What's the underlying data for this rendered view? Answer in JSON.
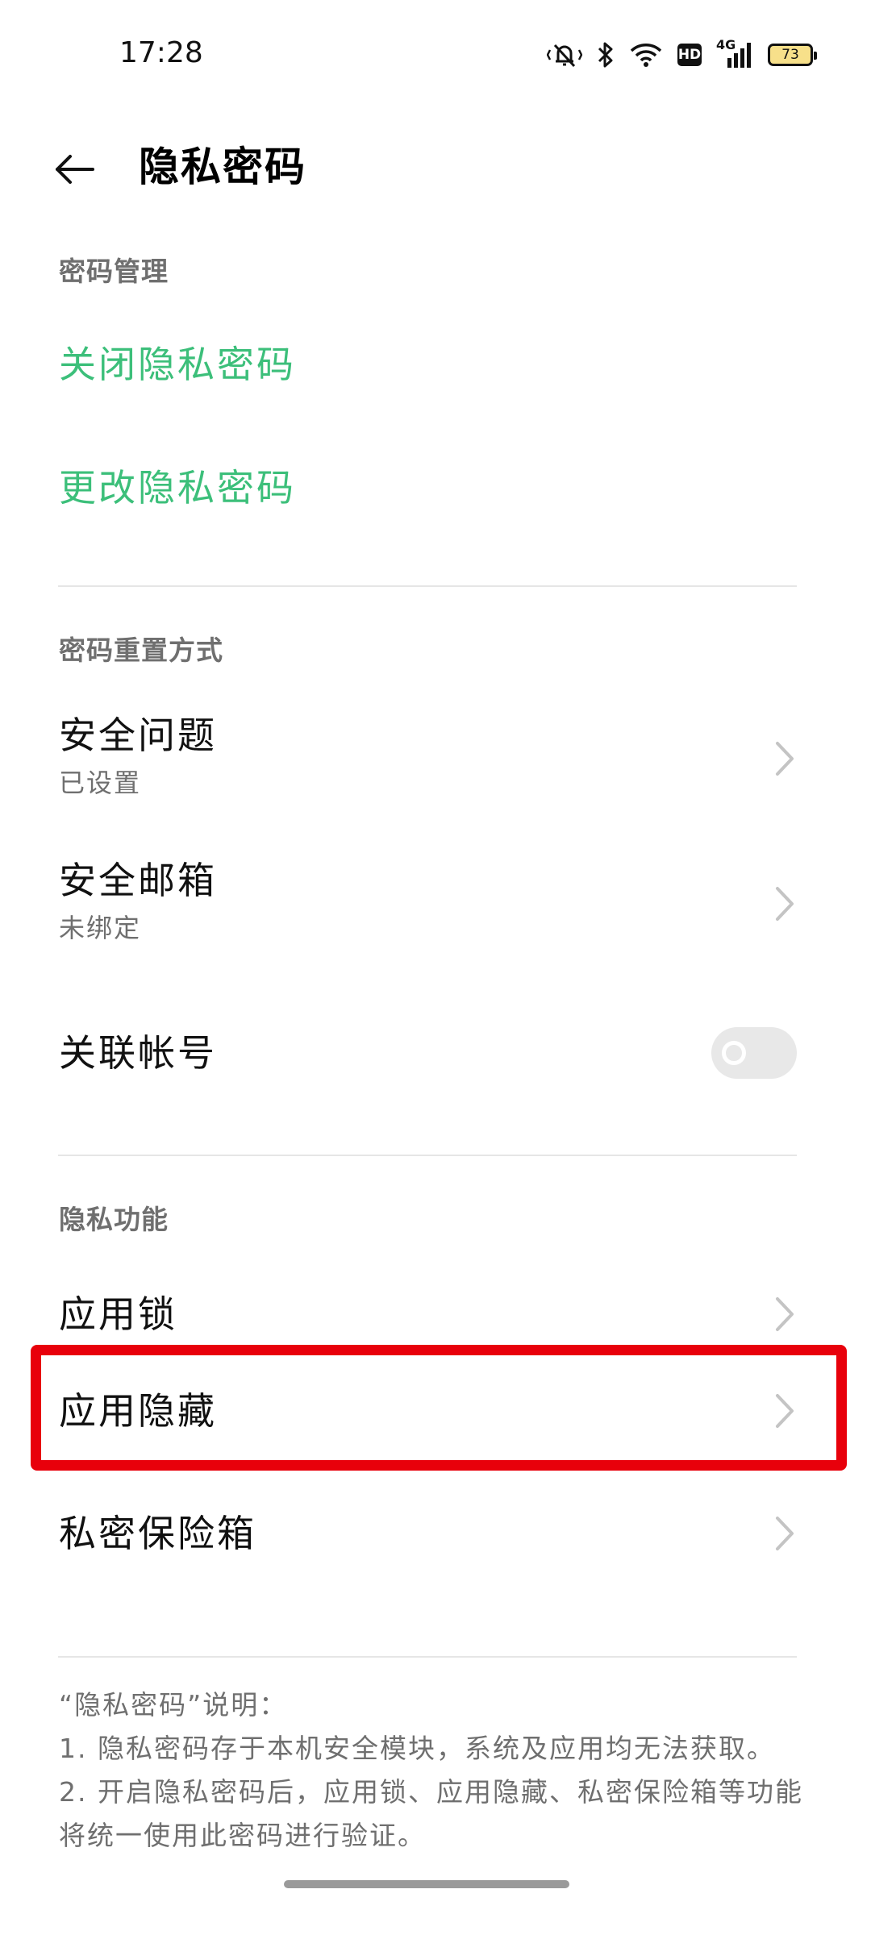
{
  "status_bar": {
    "time": "17:28",
    "hd_label": "HD",
    "network_label": "4G",
    "battery_level": "73",
    "icons": [
      "mute-vibrate-icon",
      "bluetooth-icon",
      "wifi-icon",
      "hd-icon",
      "cellular-signal-icon",
      "battery-icon"
    ]
  },
  "header": {
    "title": "隐私密码",
    "back_icon": "back-arrow-icon"
  },
  "sections": {
    "password_management": {
      "header": "密码管理",
      "close_password": "关闭隐私密码",
      "change_password": "更改隐私密码"
    },
    "reset_method": {
      "header": "密码重置方式",
      "security_question": {
        "title": "安全问题",
        "status": "已设置"
      },
      "security_email": {
        "title": "安全邮箱",
        "status": "未绑定"
      },
      "linked_account": {
        "title": "关联帐号",
        "enabled": false
      }
    },
    "privacy_features": {
      "header": "隐私功能",
      "app_lock": "应用锁",
      "app_hide": "应用隐藏",
      "private_safe": "私密保险箱"
    }
  },
  "notes": {
    "title": "“隐私密码”说明：",
    "line1": "1. 隐私密码存于本机安全模块，系统及应用均无法获取。",
    "line2a": "2. 开启隐私密码后，应用锁、应用隐藏、私密保险箱等功能",
    "line2b": "将统一使用此密码进行验证。"
  },
  "colors": {
    "accent_green": "#3cbf7a",
    "highlight_red": "#e8000b",
    "secondary_text": "#6f6f6f"
  }
}
